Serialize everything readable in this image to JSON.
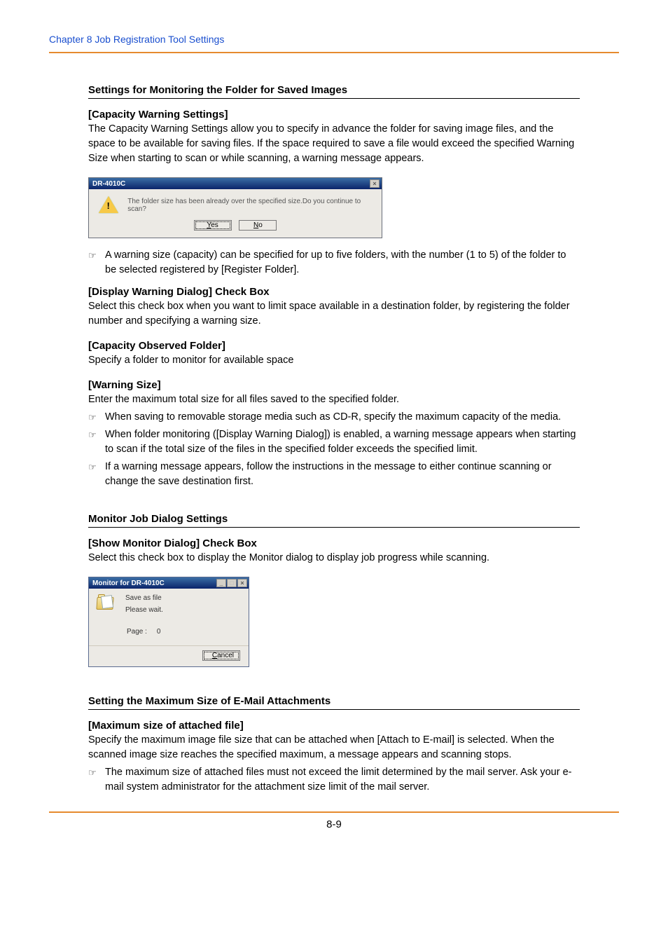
{
  "header": {
    "chapter_line": "Chapter 8   Job Registration Tool Settings"
  },
  "sec1": {
    "title": "Settings for Monitoring the Folder for Saved Images",
    "h1": "[Capacity Warning Settings]",
    "p1": "The Capacity Warning Settings allow you to specify in advance the folder for saving image files, and the space to be available for saving files. If the space required to save a file would exceed the specified Warning Size when starting to scan or while scanning, a warning message appears.",
    "note1": "A warning size (capacity) can be specified for up to five folders, with the number (1 to 5) of the folder to be selected registered by [Register Folder].",
    "h2": "[Display Warning Dialog] Check Box",
    "p2": "Select this check box when you want to limit space available in a destination folder, by registering the folder number and specifying a warning size.",
    "h3": "[Capacity Observed Folder]",
    "p3": "Specify a folder to monitor for available space",
    "h4": "[Warning Size]",
    "p4": "Enter the maximum total size for all files saved to the specified folder.",
    "note2": "When saving to removable storage media such as CD-R, specify the maximum capacity of the media.",
    "note3": "When folder monitoring ([Display Warning Dialog]) is enabled, a warning message appears when starting to scan if the total size of the files in the specified folder exceeds the specified limit.",
    "note4": "If a warning message appears, follow the instructions in the message to either continue scanning or change the save destination first."
  },
  "dlg1": {
    "title": "DR-4010C",
    "msg": "The folder size has been already over the specified size.Do you continue to scan?",
    "yes_rest": "es",
    "no_rest": "o"
  },
  "sec2": {
    "title": "Monitor Job Dialog Settings",
    "h1": "[Show Monitor Dialog] Check Box",
    "p1": "Select this check box to display the Monitor dialog to display job progress while scanning."
  },
  "dlg2": {
    "title": "Monitor for DR-4010C",
    "line1": "Save as file",
    "line2": "Please wait.",
    "page_label": "Page :",
    "page_value": "0",
    "cancel_rest": "ancel"
  },
  "sec3": {
    "title": "Setting the Maximum Size of E-Mail Attachments",
    "h1": "[Maximum size of attached file]",
    "p1": "Specify the maximum image file size that can be attached when [Attach to E-mail] is selected. When the scanned image size reaches the specified maximum, a message appears and scanning stops.",
    "note1": "The maximum size of attached files must not exceed the limit determined by the mail server. Ask your e-mail system administrator for the attachment size limit of the mail server."
  },
  "footer": {
    "page_number": "8-9"
  }
}
